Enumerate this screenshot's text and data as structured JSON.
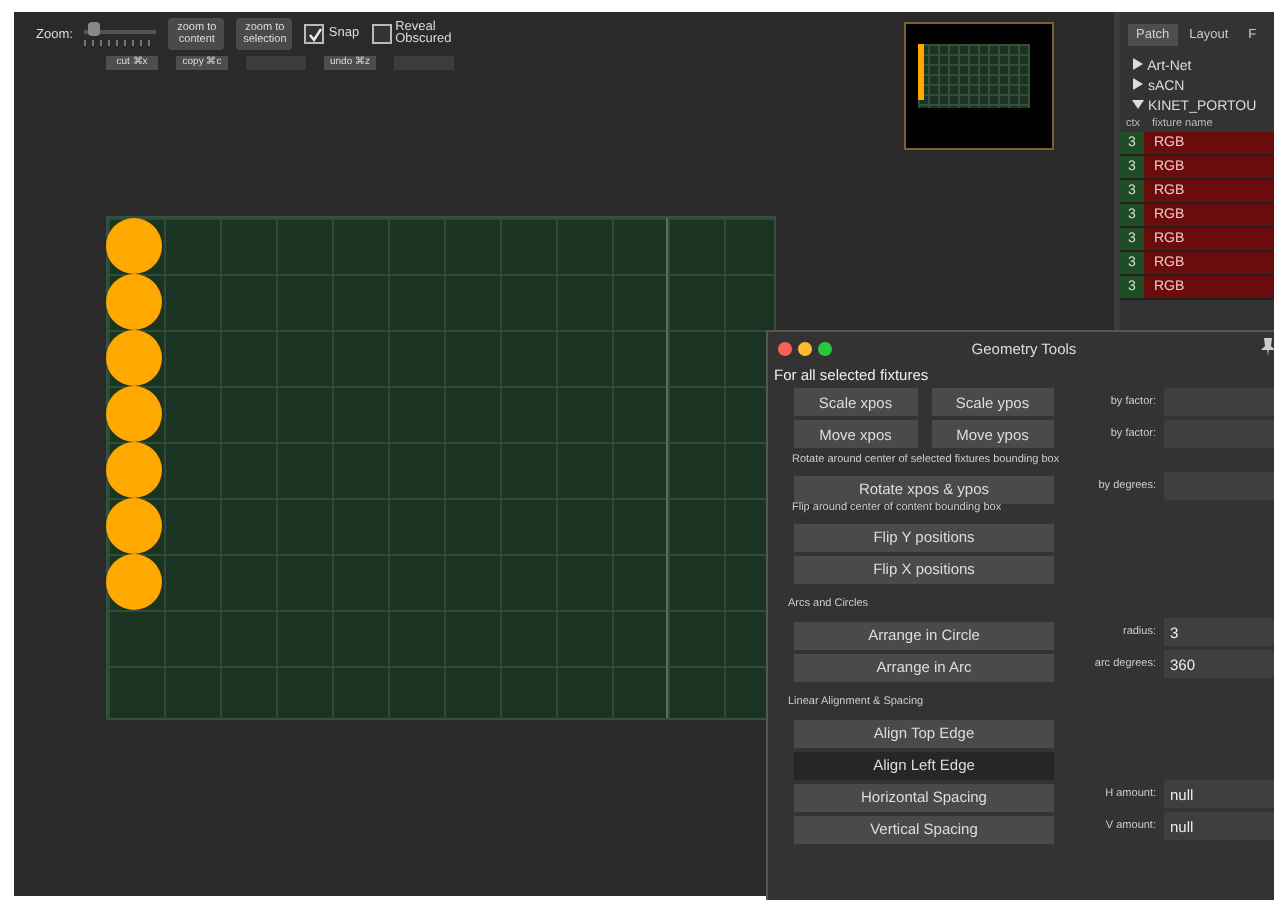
{
  "toolbar": {
    "zoom_label": "Zoom:",
    "zoom_slider": {
      "level": 0.05
    },
    "view_buttons": [
      {
        "label": "zoom to content"
      },
      {
        "label": "zoom to selection"
      }
    ],
    "checkboxes": [
      {
        "label": "Snap",
        "checked": true
      },
      {
        "label": "Reveal Obscured",
        "checked": false
      }
    ],
    "edit_buttons": [
      {
        "label": "cut ⌘x",
        "disabled": false
      },
      {
        "label": "copy ⌘c",
        "disabled": false
      },
      {
        "disabled": true
      },
      {
        "label": "undo ⌘z",
        "disabled": false
      },
      {
        "disabled": true
      }
    ]
  },
  "canvas": {
    "fixtures": [
      {
        "kind": "circle"
      },
      {
        "kind": "circle"
      },
      {
        "kind": "circle"
      },
      {
        "kind": "circle"
      },
      {
        "kind": "circle"
      },
      {
        "kind": "circle"
      },
      {
        "kind": "circle"
      }
    ]
  },
  "patch_panel": {
    "tabs": [
      {
        "label": "Patch",
        "selected": true
      },
      {
        "label": "Layout",
        "selected": false
      },
      {
        "label": "F",
        "selected": false
      }
    ],
    "tree": [
      {
        "label": "Art-Net",
        "expanded": false
      },
      {
        "label": "sACN",
        "expanded": false
      },
      {
        "label": "KINET_PORTOU",
        "expanded": true
      }
    ],
    "columns": [
      "ctx",
      "fixture name"
    ],
    "rows": [
      {
        "channel": "3",
        "name": "RGB"
      },
      {
        "channel": "3",
        "name": "RGB"
      },
      {
        "channel": "3",
        "name": "RGB"
      },
      {
        "channel": "3",
        "name": "RGB"
      },
      {
        "channel": "3",
        "name": "RGB"
      },
      {
        "channel": "3",
        "name": "RGB"
      },
      {
        "channel": "3",
        "name": "RGB"
      }
    ]
  },
  "geometry_tools": {
    "title": "Geometry Tools",
    "rows": [
      {
        "kind": "heading",
        "text": "For all selected fixtures"
      },
      {
        "kind": "pair",
        "buttons": [
          {
            "label": "Scale xpos",
            "highlighted": false
          },
          {
            "label": "Scale ypos",
            "highlighted": false
          }
        ],
        "field_label": "by factor:"
      },
      {
        "kind": "pair",
        "buttons": [
          {
            "label": "Move xpos",
            "highlighted": false
          },
          {
            "label": "Move ypos",
            "highlighted": false
          }
        ],
        "field_label": "by factor:"
      },
      {
        "kind": "caption",
        "text": "Rotate around center of selected fixtures bounding box"
      },
      {
        "kind": "wide",
        "buttons": [
          {
            "label": "Rotate xpos & ypos",
            "highlighted": false
          }
        ],
        "field_label": "by degrees:"
      },
      {
        "kind": "caption",
        "text": "Flip around center of content bounding box"
      },
      {
        "kind": "wide",
        "buttons": [
          {
            "label": "Flip Y positions",
            "highlighted": false
          }
        ]
      },
      {
        "kind": "wide",
        "buttons": [
          {
            "label": "Flip X positions",
            "highlighted": false
          }
        ]
      },
      {
        "kind": "section",
        "text": "Arcs and Circles"
      },
      {
        "kind": "wide",
        "buttons": [
          {
            "label": "Arrange in Circle",
            "highlighted": false
          }
        ],
        "field_label": "radius:",
        "value": "3"
      },
      {
        "kind": "wide",
        "buttons": [
          {
            "label": "Arrange in Arc",
            "highlighted": false
          }
        ],
        "field_label": "arc degrees:",
        "value": "360"
      },
      {
        "kind": "section",
        "text": "Linear Alignment & Spacing"
      },
      {
        "kind": "wide",
        "buttons": [
          {
            "label": "Align Top Edge",
            "highlighted": false
          }
        ]
      },
      {
        "kind": "wide",
        "buttons": [
          {
            "label": "Align Left Edge",
            "highlighted": true
          }
        ]
      },
      {
        "kind": "wide",
        "buttons": [
          {
            "label": "Horizontal Spacing",
            "highlighted": false
          }
        ],
        "field_label": "H amount:",
        "value": "null"
      },
      {
        "kind": "wide",
        "buttons": [
          {
            "label": "Vertical Spacing",
            "highlighted": false
          }
        ],
        "field_label": "V amount:",
        "value": "null"
      }
    ]
  }
}
